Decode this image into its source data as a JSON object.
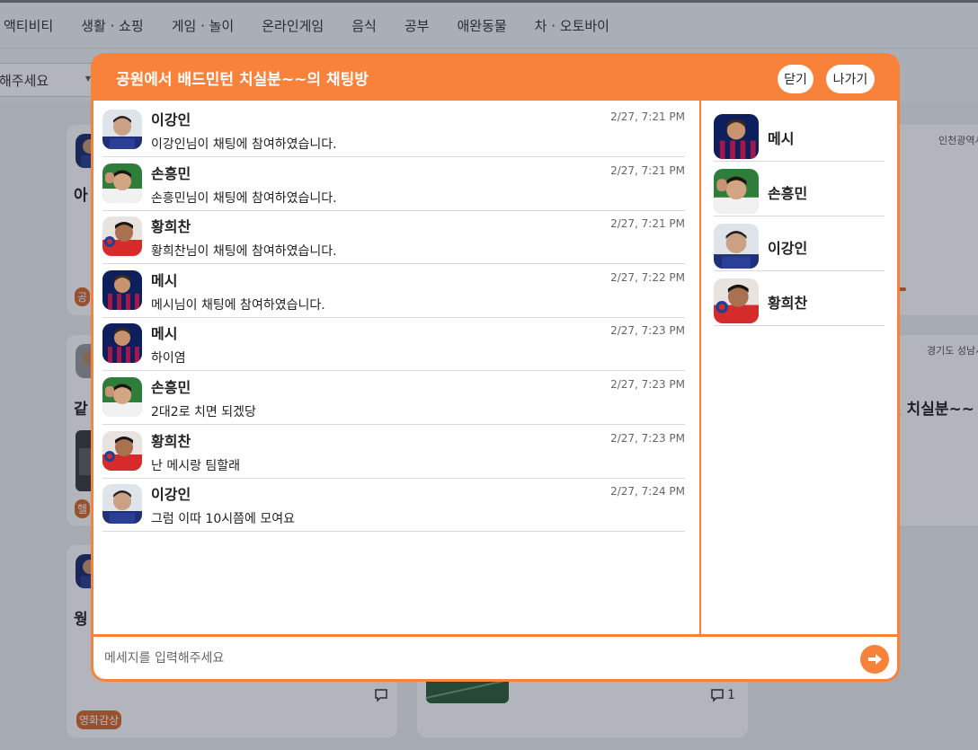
{
  "nav": {
    "categories": [
      "액티비티",
      "생활 · 쇼핑",
      "게임 · 놀이",
      "온라인게임",
      "음식",
      "공부",
      "애완동물",
      "차 · 오토바이"
    ]
  },
  "filter": {
    "region_value": "해주세요"
  },
  "background_cards": {
    "card1": {
      "title_fragment": "아",
      "tag": "공"
    },
    "card2": {
      "title_fragment": "같",
      "tag": "헬"
    },
    "card3": {
      "title_fragment": "웡",
      "tag": "영화감상"
    },
    "right1": {
      "location": "인천광역시"
    },
    "right2": {
      "location": "경기도 성남시",
      "title_fragment": "턴 치실분~~"
    },
    "bottom_card": {
      "comment_count": "1"
    }
  },
  "chat": {
    "title": "공원에서 배드민턴 치실분~~의 채팅방",
    "close_label": "닫기",
    "leave_label": "나가기",
    "input_placeholder": "메세지를 입력해주세요",
    "messages": [
      {
        "name": "이강인",
        "time": "2/27, 7:21 PM",
        "text": "이강인님이 채팅에 참여하였습니다.",
        "avatar": "blue"
      },
      {
        "name": "손흥민",
        "time": "2/27, 7:21 PM",
        "text": "손흥민님이 채팅에 참여하였습니다.",
        "avatar": "green"
      },
      {
        "name": "황희찬",
        "time": "2/27, 7:21 PM",
        "text": "황희찬님이 채팅에 참여하였습니다.",
        "avatar": "red"
      },
      {
        "name": "메시",
        "time": "2/27, 7:22 PM",
        "text": "메시님이 채팅에 참여하였습니다.",
        "avatar": "barca"
      },
      {
        "name": "메시",
        "time": "2/27, 7:23 PM",
        "text": "하이염",
        "avatar": "barca"
      },
      {
        "name": "손흥민",
        "time": "2/27, 7:23 PM",
        "text": "2대2로 치면 되겠당",
        "avatar": "green"
      },
      {
        "name": "황희찬",
        "time": "2/27, 7:23 PM",
        "text": "난 메시랑 팀할래",
        "avatar": "red"
      },
      {
        "name": "이강인",
        "time": "2/27, 7:24 PM",
        "text": "그럼 이따 10시쯤에 모여요",
        "avatar": "blue"
      }
    ],
    "members": [
      {
        "name": "메시",
        "avatar": "barca"
      },
      {
        "name": "손흥민",
        "avatar": "green"
      },
      {
        "name": "이강인",
        "avatar": "blue"
      },
      {
        "name": "황희찬",
        "avatar": "red"
      }
    ]
  },
  "colors": {
    "accent": "#f9823a",
    "overlay": "rgba(20,30,50,0.33)"
  },
  "icons": {
    "send": "arrow-right-icon",
    "comment": "speech-bubble-icon",
    "dropdown": "chevron-down-icon"
  }
}
